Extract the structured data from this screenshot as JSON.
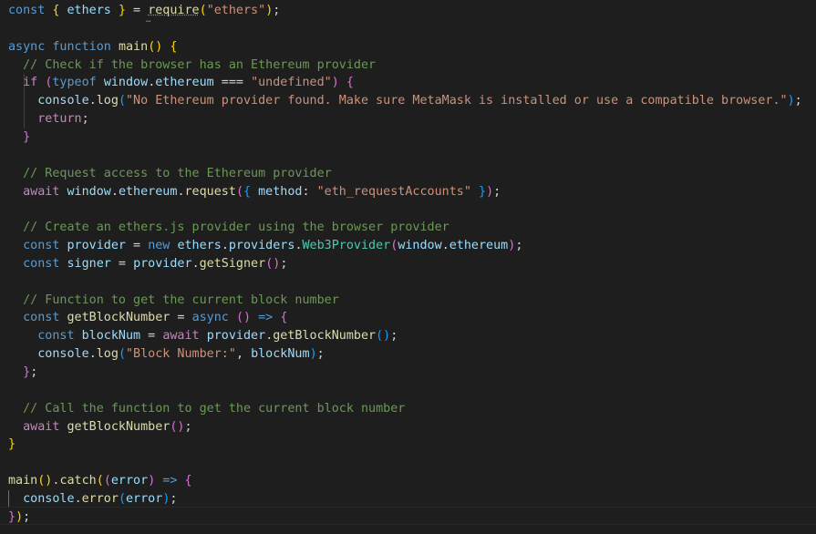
{
  "editor": {
    "language": "javascript",
    "theme": "dark",
    "colors": {
      "background": "#1e1e1e",
      "keyword": "#569cd6",
      "control": "#c586c0",
      "variable": "#9cdcfe",
      "function": "#dcdcaa",
      "string": "#ce9178",
      "comment": "#6a9955",
      "class": "#4ec9b0",
      "punctuation": "#d4d4d4",
      "bracket_gold": "#ffd700",
      "bracket_pink": "#da70d6",
      "bracket_blue": "#179fff"
    },
    "lines": [
      [
        [
          "const",
          "k"
        ],
        [
          " ",
          "p"
        ],
        [
          "{",
          "b1"
        ],
        [
          " ",
          "p"
        ],
        [
          "ethers",
          "c"
        ],
        [
          " ",
          "p"
        ],
        [
          "}",
          "b1"
        ],
        [
          " = ",
          "p"
        ],
        [
          "require",
          "f"
        ],
        [
          "(",
          "b1"
        ],
        [
          "\"ethers\"",
          "s"
        ],
        [
          ")",
          "b1"
        ],
        [
          ";",
          "p"
        ]
      ],
      [],
      [
        [
          "async",
          "k"
        ],
        [
          " ",
          "p"
        ],
        [
          "function",
          "k"
        ],
        [
          " ",
          "p"
        ],
        [
          "main",
          "f"
        ],
        [
          "()",
          "b1"
        ],
        [
          " ",
          "p"
        ],
        [
          "{",
          "b1"
        ]
      ],
      [
        [
          "  ",
          "p"
        ],
        [
          "// Check if the browser has an Ethereum provider",
          "cm"
        ]
      ],
      [
        [
          "  ",
          "p"
        ],
        [
          "if",
          "ct"
        ],
        [
          " ",
          "p"
        ],
        [
          "(",
          "b2"
        ],
        [
          "typeof",
          "k"
        ],
        [
          " ",
          "p"
        ],
        [
          "window",
          "v"
        ],
        [
          ".",
          "p"
        ],
        [
          "ethereum",
          "v"
        ],
        [
          " === ",
          "p"
        ],
        [
          "\"undefined\"",
          "s"
        ],
        [
          ")",
          "b2"
        ],
        [
          " ",
          "p"
        ],
        [
          "{",
          "b2"
        ]
      ],
      [
        [
          "    ",
          "p"
        ],
        [
          "console",
          "v"
        ],
        [
          ".",
          "p"
        ],
        [
          "log",
          "f"
        ],
        [
          "(",
          "b3"
        ],
        [
          "\"No Ethereum provider found. Make sure MetaMask is installed or use a compatible browser.\"",
          "s"
        ],
        [
          ")",
          "b3"
        ],
        [
          ";",
          "p"
        ]
      ],
      [
        [
          "    ",
          "p"
        ],
        [
          "return",
          "ct"
        ],
        [
          ";",
          "p"
        ]
      ],
      [
        [
          "  ",
          "p"
        ],
        [
          "}",
          "b2"
        ]
      ],
      [],
      [
        [
          "  ",
          "p"
        ],
        [
          "// Request access to the Ethereum provider",
          "cm"
        ]
      ],
      [
        [
          "  ",
          "p"
        ],
        [
          "await",
          "ct"
        ],
        [
          " ",
          "p"
        ],
        [
          "window",
          "v"
        ],
        [
          ".",
          "p"
        ],
        [
          "ethereum",
          "v"
        ],
        [
          ".",
          "p"
        ],
        [
          "request",
          "f"
        ],
        [
          "(",
          "b2"
        ],
        [
          "{",
          "b3"
        ],
        [
          " ",
          "p"
        ],
        [
          "method",
          "v"
        ],
        [
          ": ",
          "p"
        ],
        [
          "\"eth_requestAccounts\"",
          "s"
        ],
        [
          " ",
          "p"
        ],
        [
          "}",
          "b3"
        ],
        [
          ")",
          "b2"
        ],
        [
          ";",
          "p"
        ]
      ],
      [],
      [
        [
          "  ",
          "p"
        ],
        [
          "// Create an ethers.js provider using the browser provider",
          "cm"
        ]
      ],
      [
        [
          "  ",
          "p"
        ],
        [
          "const",
          "k"
        ],
        [
          " ",
          "p"
        ],
        [
          "provider",
          "c"
        ],
        [
          " = ",
          "p"
        ],
        [
          "new",
          "k"
        ],
        [
          " ",
          "p"
        ],
        [
          "ethers",
          "v"
        ],
        [
          ".",
          "p"
        ],
        [
          "providers",
          "v"
        ],
        [
          ".",
          "p"
        ],
        [
          "Web3Provider",
          "cl"
        ],
        [
          "(",
          "b2"
        ],
        [
          "window",
          "v"
        ],
        [
          ".",
          "p"
        ],
        [
          "ethereum",
          "v"
        ],
        [
          ")",
          "b2"
        ],
        [
          ";",
          "p"
        ]
      ],
      [
        [
          "  ",
          "p"
        ],
        [
          "const",
          "k"
        ],
        [
          " ",
          "p"
        ],
        [
          "signer",
          "c"
        ],
        [
          " = ",
          "p"
        ],
        [
          "provider",
          "c"
        ],
        [
          ".",
          "p"
        ],
        [
          "getSigner",
          "f"
        ],
        [
          "()",
          "b2"
        ],
        [
          ";",
          "p"
        ]
      ],
      [],
      [
        [
          "  ",
          "p"
        ],
        [
          "// Function to get the current block number",
          "cm"
        ]
      ],
      [
        [
          "  ",
          "p"
        ],
        [
          "const",
          "k"
        ],
        [
          " ",
          "p"
        ],
        [
          "getBlockNumber",
          "f"
        ],
        [
          " = ",
          "p"
        ],
        [
          "async",
          "k"
        ],
        [
          " ",
          "p"
        ],
        [
          "()",
          "b2"
        ],
        [
          " ",
          "p"
        ],
        [
          "=>",
          "k"
        ],
        [
          " ",
          "p"
        ],
        [
          "{",
          "b2"
        ]
      ],
      [
        [
          "    ",
          "p"
        ],
        [
          "const",
          "k"
        ],
        [
          " ",
          "p"
        ],
        [
          "blockNum",
          "c"
        ],
        [
          " = ",
          "p"
        ],
        [
          "await",
          "ct"
        ],
        [
          " ",
          "p"
        ],
        [
          "provider",
          "c"
        ],
        [
          ".",
          "p"
        ],
        [
          "getBlockNumber",
          "f"
        ],
        [
          "()",
          "b3"
        ],
        [
          ";",
          "p"
        ]
      ],
      [
        [
          "    ",
          "p"
        ],
        [
          "console",
          "v"
        ],
        [
          ".",
          "p"
        ],
        [
          "log",
          "f"
        ],
        [
          "(",
          "b3"
        ],
        [
          "\"Block Number:\"",
          "s"
        ],
        [
          ", ",
          "p"
        ],
        [
          "blockNum",
          "c"
        ],
        [
          ")",
          "b3"
        ],
        [
          ";",
          "p"
        ]
      ],
      [
        [
          "  ",
          "p"
        ],
        [
          "}",
          "b2"
        ],
        [
          ";",
          "p"
        ]
      ],
      [],
      [
        [
          "  ",
          "p"
        ],
        [
          "// Call the function to get the current block number",
          "cm"
        ]
      ],
      [
        [
          "  ",
          "p"
        ],
        [
          "await",
          "ct"
        ],
        [
          " ",
          "p"
        ],
        [
          "getBlockNumber",
          "f"
        ],
        [
          "()",
          "b2"
        ],
        [
          ";",
          "p"
        ]
      ],
      [
        [
          "}",
          "b1"
        ]
      ],
      [],
      [
        [
          "main",
          "f"
        ],
        [
          "()",
          "b1"
        ],
        [
          ".",
          "p"
        ],
        [
          "catch",
          "f"
        ],
        [
          "(",
          "b1"
        ],
        [
          "(",
          "b2"
        ],
        [
          "error",
          "v"
        ],
        [
          ")",
          "b2"
        ],
        [
          " ",
          "p"
        ],
        [
          "=>",
          "k"
        ],
        [
          " ",
          "p"
        ],
        [
          "{",
          "b2"
        ]
      ],
      [
        [
          "  ",
          "p"
        ],
        [
          "console",
          "v"
        ],
        [
          ".",
          "p"
        ],
        [
          "error",
          "f"
        ],
        [
          "(",
          "b3"
        ],
        [
          "error",
          "v"
        ],
        [
          ")",
          "b3"
        ],
        [
          ";",
          "p"
        ]
      ],
      [
        [
          "}",
          "b2"
        ],
        [
          ")",
          "b1"
        ],
        [
          ";",
          "p"
        ]
      ]
    ]
  }
}
